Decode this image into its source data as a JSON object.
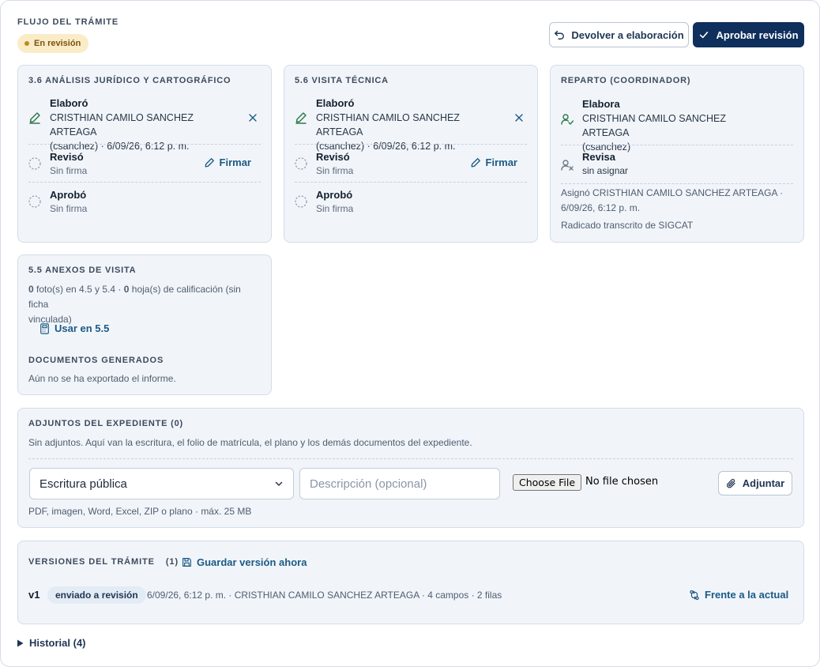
{
  "header": {
    "title": "FLUJO DEL TRÁMITE",
    "status_badge": "En revisión",
    "return_button": "Devolver a elaboración",
    "approve_button": "Aprobar revisión"
  },
  "cards": [
    {
      "title": "3.6 ANÁLISIS JURÍDICO Y CARTOGRÁFICO",
      "elaboro": {
        "label": "Elaboró",
        "line1": "CRISTHIAN CAMILO SANCHEZ ARTEAGA",
        "line2": "(csanchez) · 6/09/26, 6:12 p. m."
      },
      "reviso": {
        "label": "Revisó",
        "status": "Sin firma",
        "action": "Firmar"
      },
      "aprobo": {
        "label": "Aprobó",
        "status": "Sin firma"
      }
    },
    {
      "title": "5.6 VISITA TÉCNICA",
      "elaboro": {
        "label": "Elaboró",
        "line1": "CRISTHIAN CAMILO SANCHEZ ARTEAGA",
        "line2": "(csanchez) · 6/09/26, 6:12 p. m."
      },
      "reviso": {
        "label": "Revisó",
        "status": "Sin firma",
        "action": "Firmar"
      },
      "aprobo": {
        "label": "Aprobó",
        "status": "Sin firma"
      }
    }
  ],
  "reparto": {
    "title": "REPARTO (COORDINADOR)",
    "elabora": {
      "label": "Elabora",
      "line1": "CRISTHIAN CAMILO SANCHEZ ARTEAGA",
      "line2": "(csanchez)"
    },
    "revisa": {
      "label": "Revisa",
      "status": "sin asignar"
    },
    "assigned_line1": "Asignó CRISTHIAN CAMILO SANCHEZ ARTEAGA ·",
    "assigned_line2": "6/09/26, 6:12 p. m.",
    "radicado": "Radicado transcrito de SIGCAT"
  },
  "anexos": {
    "title": "5.5 ANEXOS DE VISITA",
    "count_photos": "0",
    "text_photos": " foto(s) en 4.5 y 5.4 · ",
    "count_sheets": "0",
    "text_sheets": " hoja(s) de calificación (sin ficha",
    "text_line2": "vinculada)",
    "use_link": "Usar en 5.5",
    "docs_title": "DOCUMENTOS GENERADOS",
    "docs_status": "Aún no se ha exportado el informe."
  },
  "adjuntos": {
    "title": "ADJUNTOS DEL EXPEDIENTE (0)",
    "empty_text": "Sin adjuntos. Aquí van la escritura, el folio de matrícula, el plano y los demás documentos del expediente.",
    "select_value": "Escritura pública",
    "description_placeholder": "Descripción (opcional)",
    "choose_file": "Choose File",
    "no_file": "No file chosen",
    "attach_button": "Adjuntar",
    "hint": "PDF, imagen, Word, Excel, ZIP o plano · máx. 25 MB"
  },
  "versiones": {
    "title": "VERSIONES DEL TRÁMITE",
    "count": "(1)",
    "save_link": "Guardar versión ahora",
    "items": [
      {
        "version": "v1",
        "badge": "enviado a revisión",
        "meta": "6/09/26, 6:12 p. m. · CRISTHIAN CAMILO SANCHEZ ARTEAGA · 4 campos · 2 filas",
        "compare": "Frente a la actual"
      }
    ]
  },
  "historial": {
    "label": "Historial (4)"
  },
  "colors": {
    "primary": "#0f2f5c",
    "link": "#1b5a84",
    "card_bg": "#f1f5fa",
    "badge_bg": "#fbecc8",
    "badge_dot": "#c08a1e",
    "sign_green": "#2e7a4a"
  },
  "icons": {
    "return": "undo-arrow-icon",
    "approve": "check-icon",
    "signed": "pen-signed-icon",
    "remove": "close-icon",
    "pending": "dashed-circle-icon",
    "sign": "pen-icon",
    "user_check": "user-check-icon",
    "user_x": "user-x-icon",
    "calculator": "calculator-icon",
    "save": "save-icon",
    "compare": "compare-arrows-icon",
    "attach": "paperclip-icon",
    "chevron": "chevron-down-icon",
    "disclosure": "triangle-right-icon"
  }
}
